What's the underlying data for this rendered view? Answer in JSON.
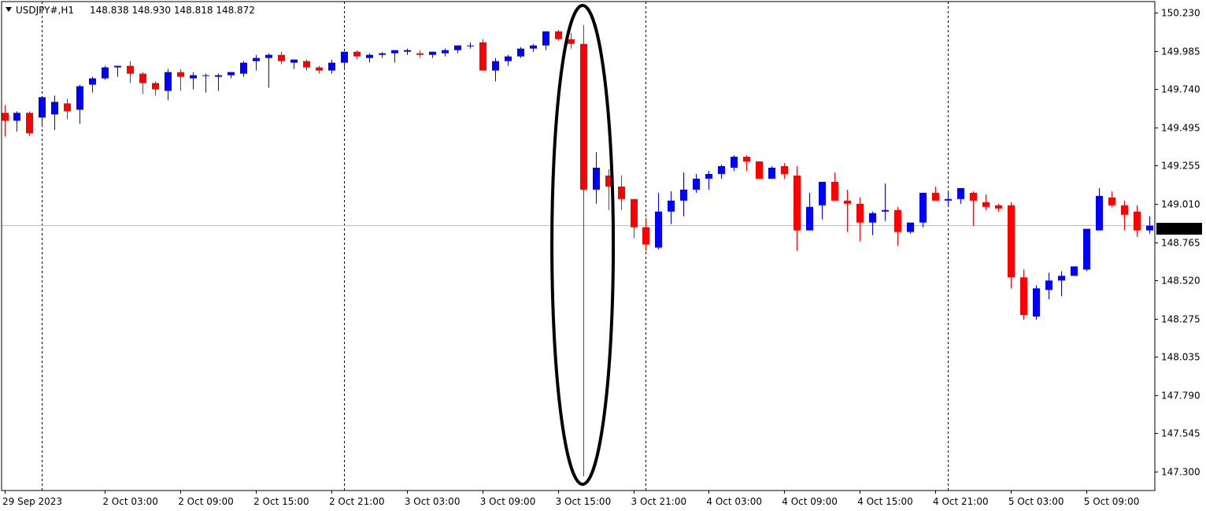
{
  "header": {
    "symbol_timeframe": "USDJPY#,H1",
    "ohlc": "148.838 148.930 148.818 148.872"
  },
  "colors": {
    "bull": "#0000ff",
    "bear": "#ff0000",
    "grid": "#000000",
    "frame": "#000000",
    "price_line": "#c0c0c0",
    "price_label_bg": "#000000",
    "price_label_text": "#ffffff",
    "annotation": "#000000"
  },
  "annotation": {
    "shape": "ellipse",
    "highlights_bar_index": 44
  },
  "chart_data": {
    "type": "candlestick",
    "symbol": "USDJPY#",
    "timeframe": "H1",
    "ylim": [
      147.18,
      150.3
    ],
    "y_ticks": [
      "150.230",
      "149.985",
      "149.740",
      "149.495",
      "149.255",
      "149.010",
      "148.765",
      "148.520",
      "148.275",
      "148.035",
      "147.790",
      "147.545",
      "147.300"
    ],
    "x_labels": [
      {
        "bar": 0,
        "label": "29 Sep 2023"
      },
      {
        "bar": 8,
        "label": "2 Oct 03:00"
      },
      {
        "bar": 14,
        "label": "2 Oct 09:00"
      },
      {
        "bar": 20,
        "label": "2 Oct 15:00"
      },
      {
        "bar": 26,
        "label": "2 Oct 21:00"
      },
      {
        "bar": 32,
        "label": "3 Oct 03:00"
      },
      {
        "bar": 38,
        "label": "3 Oct 09:00"
      },
      {
        "bar": 44,
        "label": "3 Oct 15:00"
      },
      {
        "bar": 50,
        "label": "3 Oct 21:00"
      },
      {
        "bar": 56,
        "label": "4 Oct 03:00"
      },
      {
        "bar": 62,
        "label": "4 Oct 09:00"
      },
      {
        "bar": 68,
        "label": "4 Oct 15:00"
      },
      {
        "bar": 74,
        "label": "4 Oct 21:00"
      },
      {
        "bar": 80,
        "label": "5 Oct 03:00"
      },
      {
        "bar": 86,
        "label": "5 Oct 09:00"
      }
    ],
    "grid_bars": [
      3,
      27,
      51,
      75
    ],
    "current_price": "148.872",
    "ohlc": [
      [
        149.59,
        149.64,
        149.44,
        149.54
      ],
      [
        149.54,
        149.6,
        149.47,
        149.59
      ],
      [
        149.59,
        149.6,
        149.44,
        149.46
      ],
      [
        149.56,
        149.59,
        149.5,
        149.69
      ],
      [
        149.58,
        149.7,
        149.48,
        149.66
      ],
      [
        149.65,
        149.68,
        149.55,
        149.6
      ],
      [
        149.61,
        149.77,
        149.52,
        149.76
      ],
      [
        149.77,
        149.82,
        149.72,
        149.81
      ],
      [
        149.81,
        149.89,
        149.8,
        149.88
      ],
      [
        149.88,
        149.89,
        149.82,
        149.89
      ],
      [
        149.89,
        149.92,
        149.78,
        149.84
      ],
      [
        149.84,
        149.85,
        149.71,
        149.78
      ],
      [
        149.78,
        149.79,
        149.7,
        149.74
      ],
      [
        149.73,
        149.87,
        149.67,
        149.85
      ],
      [
        149.85,
        149.87,
        149.73,
        149.82
      ],
      [
        149.81,
        149.85,
        149.74,
        149.83
      ],
      [
        149.83,
        149.84,
        149.72,
        149.83
      ],
      [
        149.82,
        149.84,
        149.73,
        149.83
      ],
      [
        149.83,
        149.85,
        149.81,
        149.85
      ],
      [
        149.84,
        149.92,
        149.82,
        149.91
      ],
      [
        149.92,
        149.96,
        149.86,
        149.94
      ],
      [
        149.94,
        149.97,
        149.75,
        149.96
      ],
      [
        149.96,
        149.98,
        149.9,
        149.92
      ],
      [
        149.91,
        149.93,
        149.87,
        149.93
      ],
      [
        149.92,
        149.93,
        149.86,
        149.88
      ],
      [
        149.88,
        149.89,
        149.84,
        149.86
      ],
      [
        149.86,
        149.93,
        149.84,
        149.91
      ],
      [
        149.91,
        149.98,
        149.87,
        149.98
      ],
      [
        149.98,
        149.99,
        149.93,
        149.95
      ],
      [
        149.94,
        149.97,
        149.91,
        149.96
      ],
      [
        149.96,
        149.98,
        149.94,
        149.97
      ],
      [
        149.97,
        149.99,
        149.91,
        149.99
      ],
      [
        149.98,
        150.0,
        149.96,
        149.99
      ],
      [
        149.97,
        149.99,
        149.94,
        149.96
      ],
      [
        149.96,
        149.98,
        149.94,
        149.98
      ],
      [
        149.97,
        150.0,
        149.95,
        149.99
      ],
      [
        149.99,
        150.02,
        149.97,
        150.02
      ],
      [
        150.02,
        150.04,
        150.0,
        150.02
      ],
      [
        150.04,
        150.06,
        149.86,
        149.86
      ],
      [
        149.86,
        149.94,
        149.79,
        149.92
      ],
      [
        149.92,
        149.96,
        149.89,
        149.95
      ],
      [
        149.95,
        150.01,
        149.94,
        150.0
      ],
      [
        150.0,
        150.03,
        149.98,
        150.02
      ],
      [
        150.02,
        150.11,
        149.99,
        150.11
      ],
      [
        150.11,
        150.12,
        150.05,
        150.06
      ],
      [
        150.06,
        150.1,
        150.0,
        150.03
      ],
      [
        150.03,
        150.15,
        147.27,
        149.1
      ],
      [
        149.1,
        149.34,
        149.01,
        149.24
      ],
      [
        149.19,
        149.23,
        148.97,
        149.12
      ],
      [
        149.12,
        149.19,
        148.97,
        149.04
      ],
      [
        149.04,
        149.04,
        148.79,
        148.86
      ],
      [
        148.86,
        148.92,
        148.71,
        148.75
      ],
      [
        148.73,
        149.08,
        148.72,
        148.96
      ],
      [
        148.96,
        149.09,
        148.88,
        149.03
      ],
      [
        149.03,
        149.21,
        148.93,
        149.1
      ],
      [
        149.1,
        149.2,
        149.08,
        149.17
      ],
      [
        149.17,
        149.22,
        149.1,
        149.2
      ],
      [
        149.2,
        149.26,
        149.17,
        149.25
      ],
      [
        149.24,
        149.32,
        149.22,
        149.31
      ],
      [
        149.31,
        149.32,
        149.22,
        149.28
      ],
      [
        149.28,
        149.28,
        149.17,
        149.17
      ],
      [
        149.17,
        149.25,
        149.17,
        149.24
      ],
      [
        149.25,
        149.27,
        149.17,
        149.2
      ],
      [
        149.19,
        149.25,
        148.71,
        148.84
      ],
      [
        148.84,
        149.08,
        148.84,
        148.99
      ],
      [
        149.0,
        149.11,
        148.91,
        149.15
      ],
      [
        149.15,
        149.21,
        149.03,
        149.03
      ],
      [
        149.03,
        149.1,
        148.83,
        149.01
      ],
      [
        149.01,
        149.05,
        148.77,
        148.89
      ],
      [
        148.89,
        148.96,
        148.81,
        148.95
      ],
      [
        148.96,
        149.14,
        148.9,
        148.97
      ],
      [
        148.97,
        148.99,
        148.74,
        148.83
      ],
      [
        148.83,
        148.88,
        148.82,
        148.89
      ],
      [
        148.89,
        149.08,
        148.86,
        149.08
      ],
      [
        149.08,
        149.12,
        149.04,
        149.03
      ],
      [
        149.03,
        149.09,
        148.99,
        149.04
      ],
      [
        149.04,
        149.11,
        149.01,
        149.11
      ],
      [
        149.08,
        149.09,
        148.87,
        149.03
      ],
      [
        149.02,
        149.07,
        148.97,
        148.99
      ],
      [
        149.0,
        149.01,
        148.96,
        148.98
      ],
      [
        149.0,
        149.02,
        148.47,
        148.54
      ],
      [
        148.54,
        148.59,
        148.27,
        148.3
      ],
      [
        148.29,
        148.49,
        148.27,
        148.47
      ],
      [
        148.46,
        148.57,
        148.4,
        148.52
      ],
      [
        148.52,
        148.58,
        148.42,
        148.55
      ],
      [
        148.55,
        148.61,
        148.55,
        148.61
      ],
      [
        148.59,
        148.85,
        148.58,
        148.85
      ],
      [
        148.84,
        149.11,
        148.84,
        149.06
      ],
      [
        149.05,
        149.09,
        148.99,
        149.0
      ],
      [
        149.0,
        149.03,
        148.84,
        148.94
      ],
      [
        148.96,
        149.0,
        148.8,
        148.84
      ],
      [
        148.84,
        148.93,
        148.82,
        148.87
      ]
    ]
  }
}
